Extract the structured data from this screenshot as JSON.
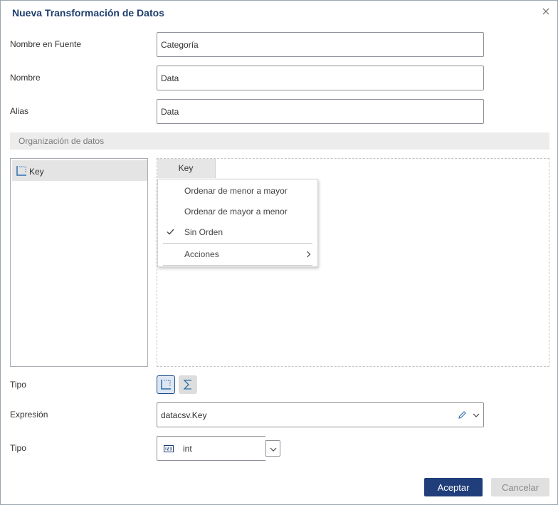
{
  "dialog": {
    "title": "Nueva Transformación de Datos"
  },
  "form": {
    "source_name_label": "Nombre en Fuente",
    "source_name_value": "Categoría",
    "name_label": "Nombre",
    "name_value": "Data",
    "alias_label": "Alias",
    "alias_value": "Data"
  },
  "organization": {
    "section_title": "Organización de datos",
    "fields": [
      {
        "label": "Key",
        "icon": "dimension-icon"
      }
    ],
    "selected_chip": "Key"
  },
  "context_menu": {
    "items": [
      {
        "label": "Ordenar de menor a mayor",
        "checked": false
      },
      {
        "label": "Ordenar de mayor a menor",
        "checked": false
      },
      {
        "label": "Sin Orden",
        "checked": true
      }
    ],
    "actions_label": "Acciones"
  },
  "tipo": {
    "label": "Tipo",
    "options": [
      "dimension-icon",
      "sigma-icon"
    ],
    "selected": "dimension-icon"
  },
  "expression": {
    "label": "Expresión",
    "value": "datacsv.Key"
  },
  "data_type": {
    "label": "Tipo",
    "value": "int",
    "icon": "number-123-icon"
  },
  "buttons": {
    "accept": "Aceptar",
    "cancel": "Cancelar"
  },
  "colors": {
    "title": "#1f3e6e",
    "primary_button": "#1f3e7a",
    "selected_border": "#1f4f8a",
    "icon_blue": "#2a6fb0"
  }
}
